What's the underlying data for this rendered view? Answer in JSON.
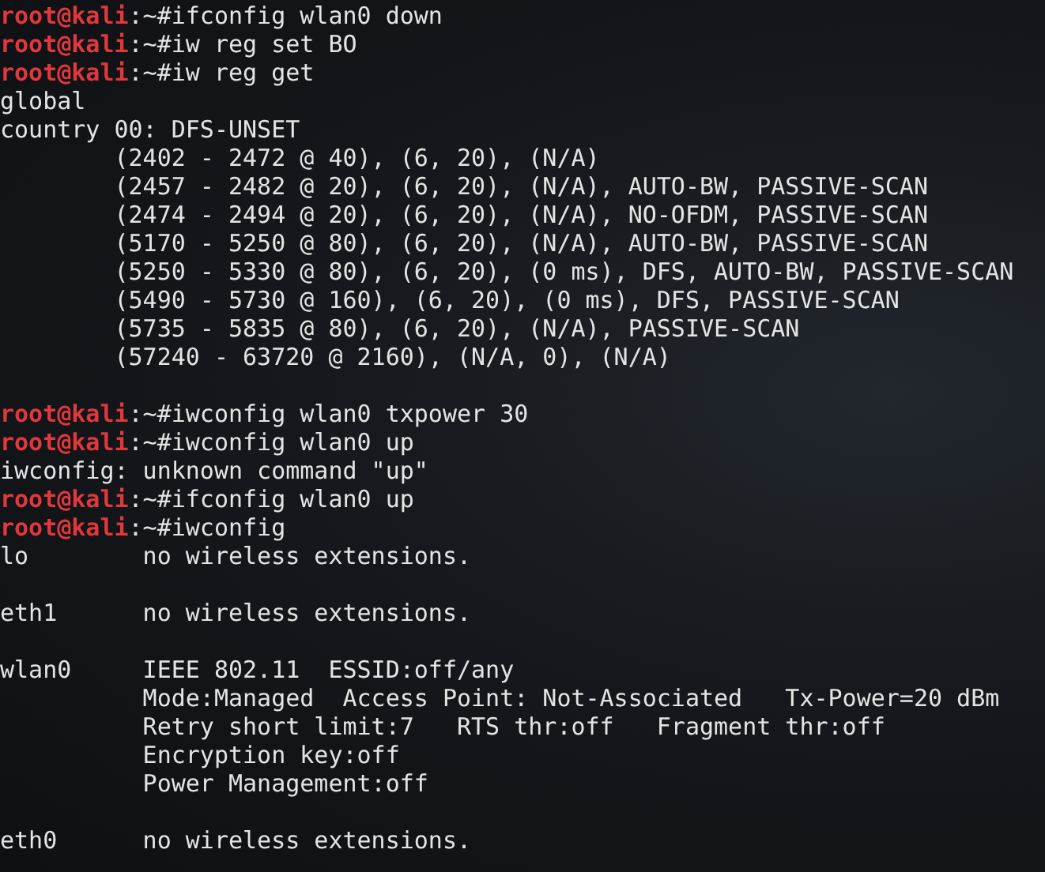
{
  "terminal": {
    "lines": [
      {
        "kind": "prompt",
        "user": "root@kali",
        "path": ":~#",
        "command": "ifconfig wlan0 down"
      },
      {
        "kind": "prompt",
        "user": "root@kali",
        "path": ":~#",
        "command": "iw reg set BO"
      },
      {
        "kind": "prompt",
        "user": "root@kali",
        "path": ":~#",
        "command": "iw reg get"
      },
      {
        "kind": "output",
        "text": "global"
      },
      {
        "kind": "output",
        "text": "country 00: DFS-UNSET"
      },
      {
        "kind": "region",
        "text": "(2402 - 2472 @ 40), (6, 20), (N/A)"
      },
      {
        "kind": "region",
        "text": "(2457 - 2482 @ 20), (6, 20), (N/A), AUTO-BW, PASSIVE-SCAN"
      },
      {
        "kind": "region",
        "text": "(2474 - 2494 @ 20), (6, 20), (N/A), NO-OFDM, PASSIVE-SCAN"
      },
      {
        "kind": "region",
        "text": "(5170 - 5250 @ 80), (6, 20), (N/A), AUTO-BW, PASSIVE-SCAN"
      },
      {
        "kind": "region",
        "text": "(5250 - 5330 @ 80), (6, 20), (0 ms), DFS, AUTO-BW, PASSIVE-SCAN"
      },
      {
        "kind": "region",
        "text": "(5490 - 5730 @ 160), (6, 20), (0 ms), DFS, PASSIVE-SCAN"
      },
      {
        "kind": "region",
        "text": "(5735 - 5835 @ 80), (6, 20), (N/A), PASSIVE-SCAN"
      },
      {
        "kind": "region",
        "text": "(57240 - 63720 @ 2160), (N/A, 0), (N/A)"
      },
      {
        "kind": "blank"
      },
      {
        "kind": "prompt",
        "user": "root@kali",
        "path": ":~#",
        "command": "iwconfig wlan0 txpower 30"
      },
      {
        "kind": "prompt",
        "user": "root@kali",
        "path": ":~#",
        "command": "iwconfig wlan0 up"
      },
      {
        "kind": "output",
        "text": "iwconfig: unknown command \"up\""
      },
      {
        "kind": "prompt",
        "user": "root@kali",
        "path": ":~#",
        "command": "ifconfig wlan0 up"
      },
      {
        "kind": "prompt",
        "user": "root@kali",
        "path": ":~#",
        "command": "iwconfig"
      },
      {
        "kind": "output",
        "text": "lo        no wireless extensions."
      },
      {
        "kind": "blank"
      },
      {
        "kind": "output",
        "text": "eth1      no wireless extensions."
      },
      {
        "kind": "blank"
      },
      {
        "kind": "output",
        "text": "wlan0     IEEE 802.11  ESSID:off/any"
      },
      {
        "kind": "detail",
        "text": "Mode:Managed  Access Point: Not-Associated   Tx-Power=20 dBm"
      },
      {
        "kind": "detail",
        "text": "Retry short limit:7   RTS thr:off   Fragment thr:off"
      },
      {
        "kind": "detail",
        "text": "Encryption key:off"
      },
      {
        "kind": "detail",
        "text": "Power Management:off"
      },
      {
        "kind": "blank"
      },
      {
        "kind": "output",
        "text": "eth0      no wireless extensions."
      }
    ]
  }
}
